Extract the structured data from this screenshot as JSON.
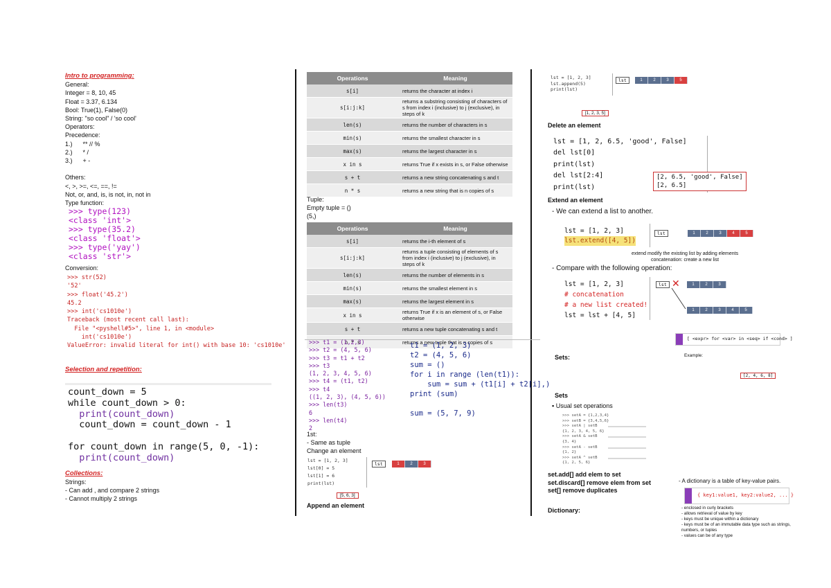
{
  "col1": {
    "intro_title": "Intro to programming:",
    "general_lines": [
      "General:",
      "Integer = 8, 10, 45",
      "Float = 3.37, 6.134",
      "Bool: True(1), False(0)",
      "String: \"so cool\" / 'so cool'",
      "Operators:",
      "Precedence:",
      "1.)      ** // %",
      "2.)      * /",
      "3.)      + -",
      "",
      "Others:",
      "<, >, >=, <=, ==, !=",
      "Not, or, and, is, is not, in, not in",
      "Type function:"
    ],
    "type_code": [
      ">>> type(123)",
      "<class 'int'>",
      ">>> type(35.2)",
      "<class 'float'>",
      ">>> type('yay')",
      "<class 'str'>"
    ],
    "conversion_label": "Conversion:",
    "conversion_code": [
      ">>> str(52)",
      "'52'",
      ">>> float('45.2')",
      "45.2",
      ">>> int('cs1010e')",
      "Traceback (most recent call last):",
      "  File \"<pyshell#5>\", line 1, in <module>",
      "    int('cs1010e')",
      "ValueError: invalid literal for int() with base 10: 'cs1010e'"
    ],
    "selection_title": "Selection and repetition:",
    "loop_code": [
      "count_down = 5",
      "while count_down > 0:",
      "  print(count_down)",
      "  count_down = count_down - 1",
      "",
      "for count_down in range(5, 0, -1):",
      "  print(count_down)"
    ],
    "collections_title": "Collections:",
    "strings_lines": [
      "Strings:",
      "- Can add , and compare 2 strings",
      "- Cannot multiply 2 strings"
    ]
  },
  "col2": {
    "table1": {
      "headers": [
        "Operations",
        "Meaning"
      ],
      "rows": [
        [
          "s[i]",
          "returns the character at index i"
        ],
        [
          "s[i:j:k]",
          "returns a substring consisting of characters of s from index i (inclusive) to j (exclusive), in steps of k"
        ],
        [
          "len(s)",
          "returns the number of characters in s"
        ],
        [
          "min(s)",
          "returns the smallest character in s"
        ],
        [
          "max(s)",
          "returns the largest character in s"
        ],
        [
          "x in s",
          "returns True if x exists in s, or False otherwise"
        ],
        [
          "s + t",
          "returns a new string concatenating s and t"
        ],
        [
          "n * s",
          "returns a new string that is n copies of s"
        ]
      ]
    },
    "tuple_lines": [
      "Tuple:",
      "Empty tuple = ()",
      "(5,)"
    ],
    "table2": {
      "headers": [
        "Operations",
        "Meaning"
      ],
      "rows": [
        [
          "s[i]",
          "returns the i-th element of s"
        ],
        [
          "s[i:j:k]",
          "returns a tuple consisting of elements of s from index i (inclusive) to j (exclusive), in steps of k"
        ],
        [
          "len(s)",
          "returns the number of elements in s"
        ],
        [
          "min(s)",
          "returns the smallest element in s"
        ],
        [
          "max(s)",
          "returns the largest element in s"
        ],
        [
          "x in s",
          "returns True if x is an element of s, or False otherwise"
        ],
        [
          "s + t",
          "returns a new tuple concatenating s and t"
        ],
        [
          "n * s",
          "returns a new tuple that is n copies of s"
        ]
      ]
    },
    "tuple_code_left": [
      ">>> t1 = (1,2,3)",
      ">>> t2 = (4, 5, 6)",
      ">>> t3 = t1 + t2",
      ">>> t3",
      "(1, 2, 3, 4, 5, 6)",
      ">>> t4 = (t1, t2)",
      ">>> t4",
      "((1, 2, 3), (4, 5, 6))",
      ">>> len(t3)",
      "6",
      ">>> len(t4)",
      "2"
    ],
    "tuple_code_right": [
      "t1 = (1, 2, 3)",
      "t2 = (4, 5, 6)",
      "sum = ()",
      "for i in range (len(t1)):",
      "    sum = sum + (t1[i] + t2[i],)",
      "print (sum)",
      "",
      "sum = (5, 7, 9)"
    ],
    "list_lines": [
      "1st:",
      "- Same as tuple",
      "Change an element"
    ],
    "change_code": [
      "lst = [1, 2, 3]",
      "lst[0] = 5",
      "lst[1] = 6",
      "print(lst)"
    ],
    "change_result": "[5, 6, 3]",
    "append_label": "Append an element"
  },
  "col3": {
    "append_code": [
      "lst = [1, 2, 3]",
      "lst.append(5)",
      "print(lst)"
    ],
    "append_result": "[1, 2, 3, 5]",
    "delete_label": "Delete an element",
    "delete_code": [
      "lst = [1, 2, 6.5, 'good', False]",
      "del lst[0]",
      "print(lst)",
      "del lst[2:4]",
      "print(lst)"
    ],
    "delete_result": [
      "[2, 6.5, 'good', False]",
      "[2, 6.5]"
    ],
    "extend_label": "Extend an element",
    "extend_intro": "- We can extend a list to another.",
    "extend_code": [
      "lst = [1, 2, 3]",
      "lst.extend([4, 5])"
    ],
    "extend_note": [
      "extend modify the existing list by adding elements",
      "concatenation: create a new list"
    ],
    "compare_intro": "- Compare with the following operation:",
    "concat_code": [
      "lst = [1, 2, 3]",
      "# concatenation",
      "# a new list created!",
      "lst = lst + [4, 5]"
    ],
    "lst_tag": "lst",
    "sets_label_1": "Sets:",
    "comprehension": "[ <expr> for <var> in <seq> if <cond> ]",
    "example_label": "Example:",
    "example_result": "[2, 4, 6, 8]",
    "sets_label_2": "Sets",
    "usual_set_ops": "Usual set operations",
    "set_code": [
      ">>> setA = {1,2,3,4}",
      ">>> setB = {3,4,5,6}",
      ">>> setA | setB",
      "{1, 2, 3, 4, 5, 6}",
      ">>> setA & setB",
      "{3, 4}",
      ">>> setA - setB",
      "{1, 2}",
      ">>> setA ^ setB",
      "{1, 2, 5, 6}"
    ],
    "set_methods": [
      "set.add[] add elem to set",
      "set.discard[] remove elem from set",
      "set[] remove duplicates"
    ],
    "dictionary_label": "Dictionary:",
    "dict_intro": "- A dictionary is a table of key-value pairs.",
    "dict_syntax": "{ key1:value1, key2:value2, ... }",
    "dict_points": [
      "- enclosed in curly brackets",
      "- allows retrieval of value by key",
      "- keys must be unique within a dictionary",
      "- keys must be of an immutable data type such as strings, numbers, or tuples",
      "- values can be of any type"
    ]
  }
}
